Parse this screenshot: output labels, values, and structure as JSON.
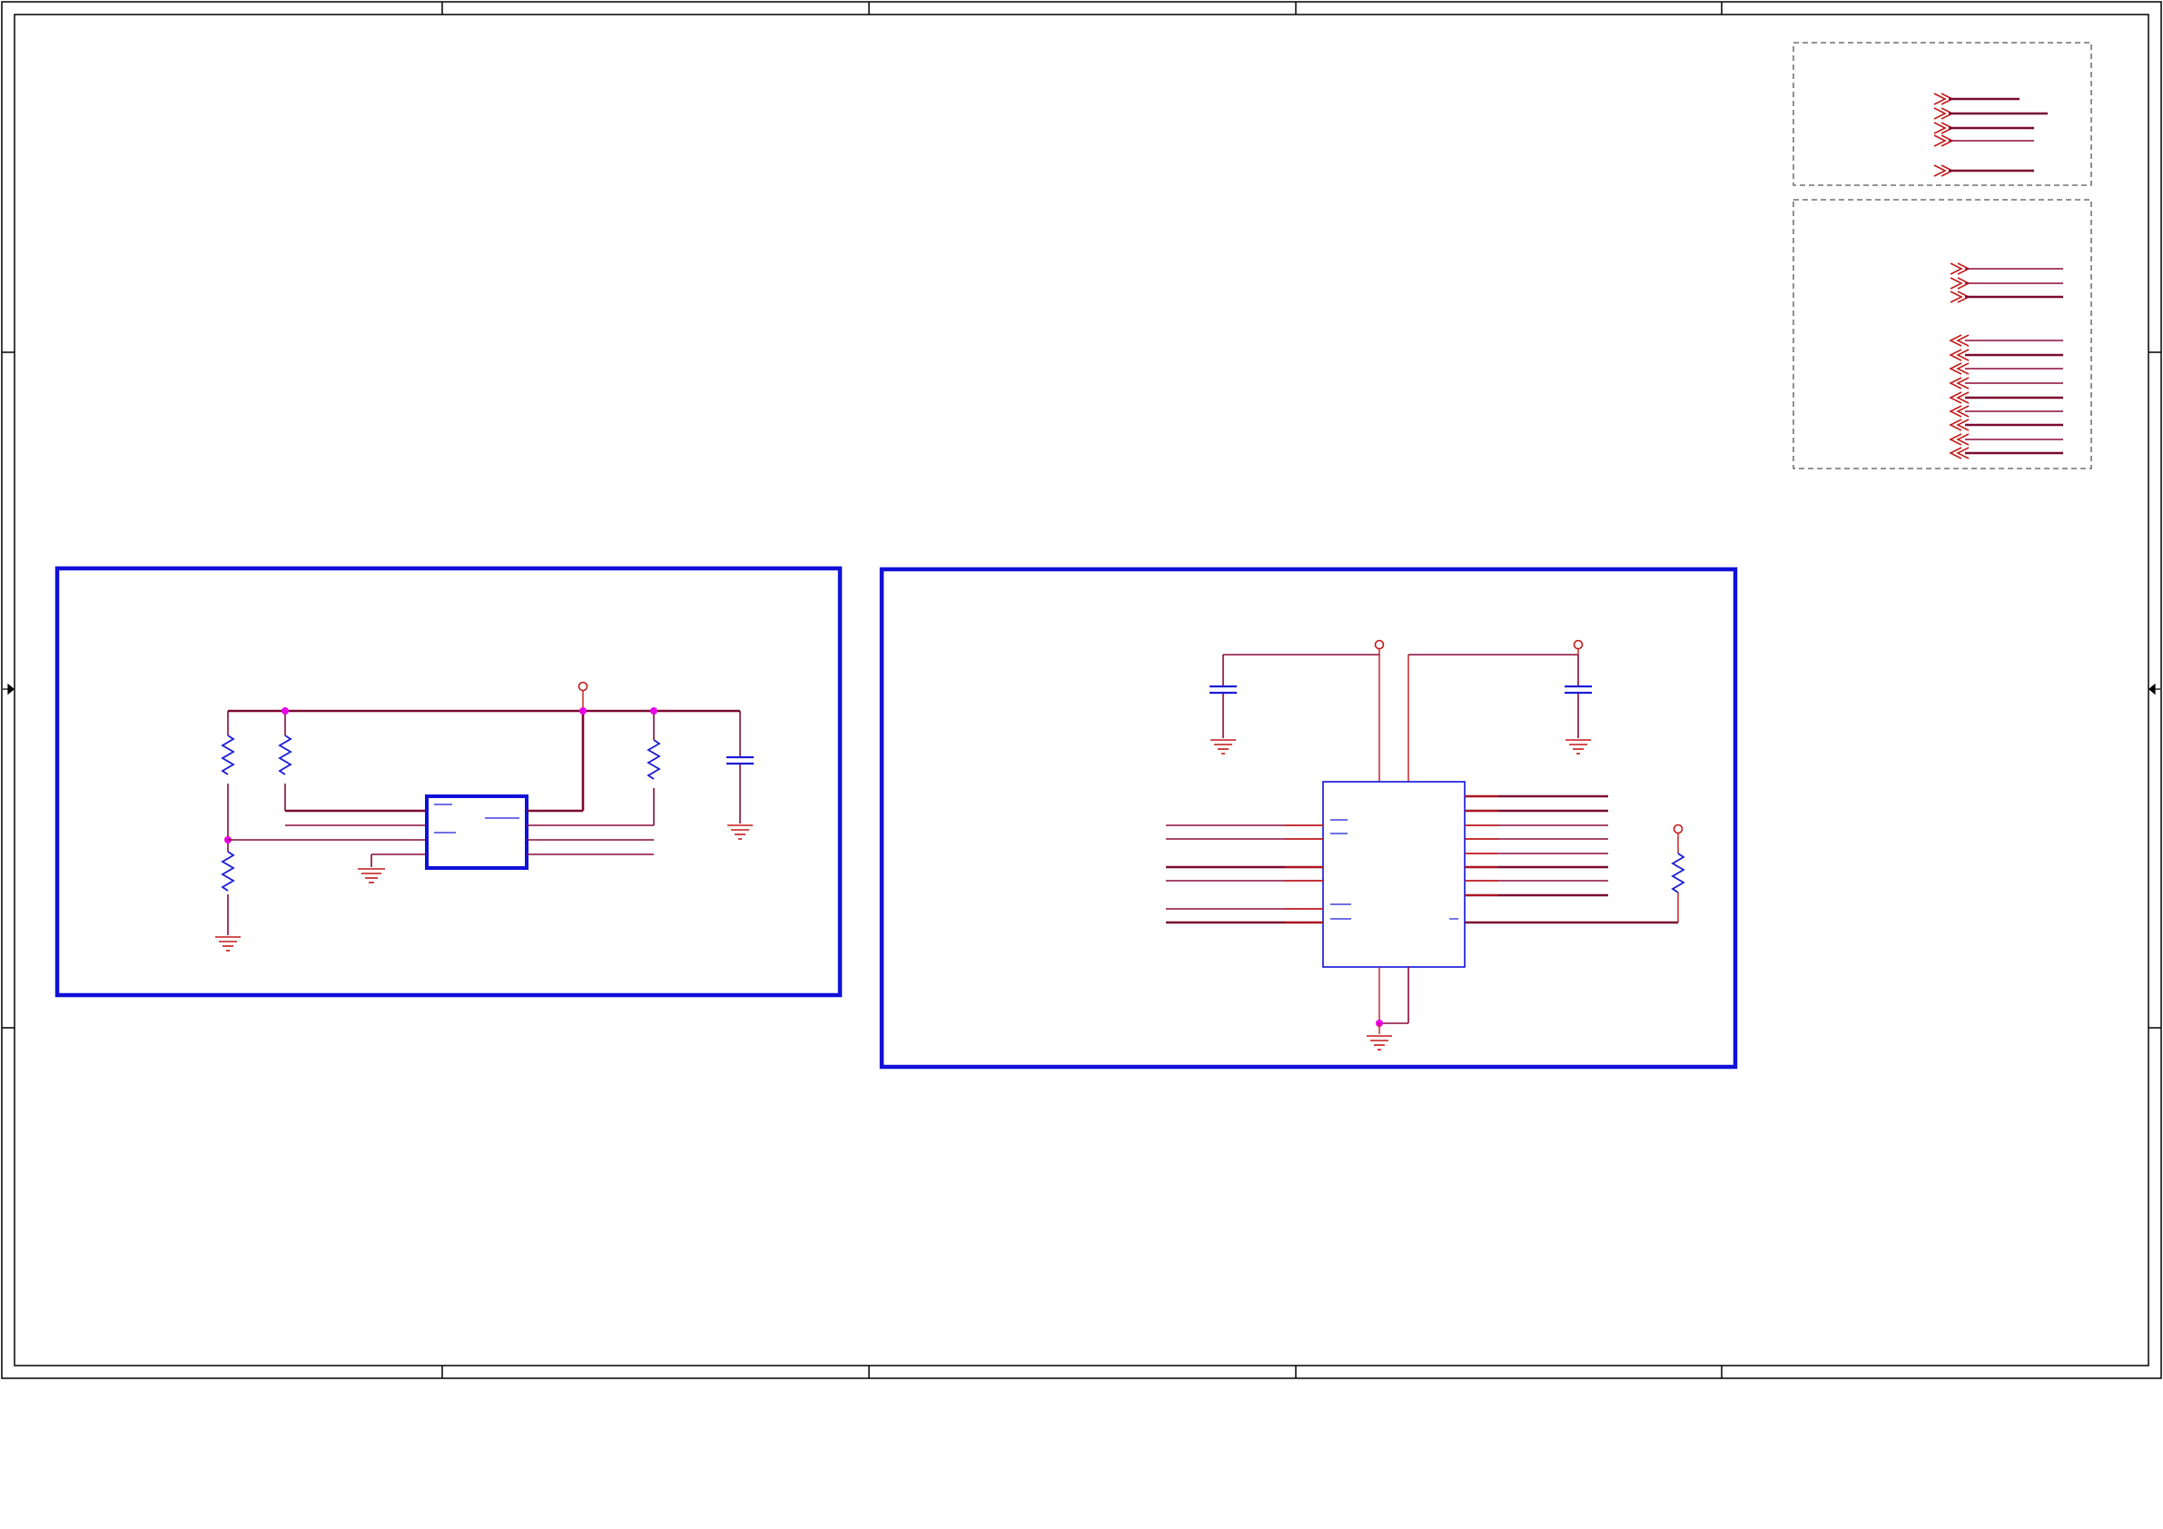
{
  "sheet": {
    "title_block_text": ""
  },
  "blocks": {
    "left_circuit": {
      "label": ""
    },
    "right_circuit": {
      "label": ""
    },
    "port_group_top": {
      "label": ""
    },
    "port_group_bottom": {
      "label": ""
    }
  },
  "colors": {
    "wire": "#8b0a3a",
    "component": "#1b1bd6",
    "block_border": "#1010d8",
    "junction": "#e800e8",
    "power_ground": "#c41818"
  }
}
